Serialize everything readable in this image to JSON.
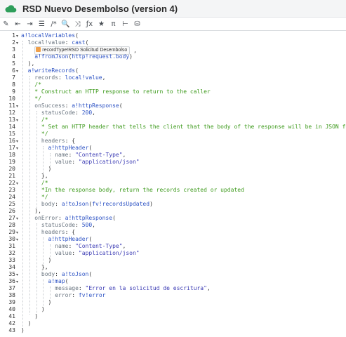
{
  "window": {
    "title": "RSD Nuevo Desembolso (version 4)"
  },
  "toolbar": {
    "icons": [
      "magic-wand-icon",
      "indent-left-icon",
      "indent-right-icon",
      "list-icon",
      "comment-icon",
      "search-icon",
      "shuffle-icon",
      "function-icon",
      "star-icon",
      "pi-icon",
      "expression-icon",
      "database-icon"
    ],
    "glyphs": [
      "✎",
      "⇤",
      "⇥",
      "☰",
      "/*",
      "🔍",
      "⤨",
      "ƒx",
      "★",
      "π",
      "⊢",
      "⛁"
    ]
  },
  "chip": {
    "label": "recordType!RSD Solicitud Desembolso"
  },
  "lines": [
    {
      "n": "1",
      "fold": true
    },
    {
      "n": "2",
      "fold": true
    },
    {
      "n": "3",
      "fold": false
    },
    {
      "n": "4",
      "fold": false
    },
    {
      "n": "5",
      "fold": false
    },
    {
      "n": "6",
      "fold": true
    },
    {
      "n": "7",
      "fold": false
    },
    {
      "n": "8",
      "fold": false
    },
    {
      "n": "9",
      "fold": false
    },
    {
      "n": "10",
      "fold": false
    },
    {
      "n": "11",
      "fold": true
    },
    {
      "n": "12",
      "fold": false
    },
    {
      "n": "13",
      "fold": true
    },
    {
      "n": "14",
      "fold": false
    },
    {
      "n": "15",
      "fold": false
    },
    {
      "n": "16",
      "fold": true
    },
    {
      "n": "17",
      "fold": true
    },
    {
      "n": "18",
      "fold": false
    },
    {
      "n": "19",
      "fold": false
    },
    {
      "n": "20",
      "fold": false
    },
    {
      "n": "21",
      "fold": false
    },
    {
      "n": "22",
      "fold": true
    },
    {
      "n": "23",
      "fold": false
    },
    {
      "n": "24",
      "fold": false
    },
    {
      "n": "25",
      "fold": false
    },
    {
      "n": "26",
      "fold": false
    },
    {
      "n": "27",
      "fold": true
    },
    {
      "n": "28",
      "fold": false
    },
    {
      "n": "29",
      "fold": true
    },
    {
      "n": "30",
      "fold": true
    },
    {
      "n": "31",
      "fold": false
    },
    {
      "n": "32",
      "fold": false
    },
    {
      "n": "33",
      "fold": false
    },
    {
      "n": "34",
      "fold": false
    },
    {
      "n": "35",
      "fold": true
    },
    {
      "n": "36",
      "fold": true
    },
    {
      "n": "37",
      "fold": false
    },
    {
      "n": "38",
      "fold": false
    },
    {
      "n": "39",
      "fold": false
    },
    {
      "n": "40",
      "fold": false
    },
    {
      "n": "41",
      "fold": false
    },
    {
      "n": "42",
      "fold": false
    },
    {
      "n": "43",
      "fold": false
    }
  ],
  "code": {
    "l1": [
      [
        "fn",
        "a!localVariables"
      ],
      [
        "pun",
        "("
      ]
    ],
    "l2": [
      [
        "key",
        "local!value"
      ],
      [
        "pun",
        ": "
      ],
      [
        "fn",
        "cast"
      ],
      [
        "pun",
        "("
      ]
    ],
    "l3": [
      [
        "pun",
        ","
      ]
    ],
    "l4": [
      [
        "fn",
        "a!fromJson"
      ],
      [
        "pun",
        "("
      ],
      [
        "fn",
        "http!request.body"
      ],
      [
        "pun",
        ")"
      ]
    ],
    "l5": [
      [
        "pun",
        "),"
      ]
    ],
    "l6": [
      [
        "fn",
        "a!writeRecords"
      ],
      [
        "pun",
        "("
      ]
    ],
    "l7": [
      [
        "key",
        "records"
      ],
      [
        "pun",
        ": "
      ],
      [
        "fn",
        "local!value"
      ],
      [
        "pun",
        ","
      ]
    ],
    "l8": [
      [
        "cm",
        "/*"
      ]
    ],
    "l9": [
      [
        "cm",
        "* Construct an HTTP response to return to the caller"
      ]
    ],
    "l10": [
      [
        "cm",
        "*/"
      ]
    ],
    "l11": [
      [
        "key",
        "onSuccess"
      ],
      [
        "pun",
        ": "
      ],
      [
        "fn",
        "a!httpResponse"
      ],
      [
        "pun",
        "("
      ]
    ],
    "l12": [
      [
        "key",
        "statusCode"
      ],
      [
        "pun",
        ": "
      ],
      [
        "num",
        "200"
      ],
      [
        "pun",
        ","
      ]
    ],
    "l13": [
      [
        "cm",
        "/*"
      ]
    ],
    "l14": [
      [
        "cm",
        "* Set an HTTP header that tells the client that the body of the response will be in JSON format"
      ]
    ],
    "l15": [
      [
        "cm",
        "*/"
      ]
    ],
    "l16": [
      [
        "key",
        "headers"
      ],
      [
        "pun",
        ": {"
      ]
    ],
    "l17": [
      [
        "fn",
        "a!httpHeader"
      ],
      [
        "pun",
        "("
      ]
    ],
    "l18": [
      [
        "key",
        "name"
      ],
      [
        "pun",
        ": "
      ],
      [
        "str",
        "\"Content-Type\""
      ],
      [
        "pun",
        ","
      ]
    ],
    "l19": [
      [
        "key",
        "value"
      ],
      [
        "pun",
        ": "
      ],
      [
        "str",
        "\"application/json\""
      ]
    ],
    "l20": [
      [
        "pun",
        ")"
      ]
    ],
    "l21": [
      [
        "pun",
        "},"
      ]
    ],
    "l22": [
      [
        "cm",
        "/*"
      ]
    ],
    "l23": [
      [
        "cm",
        "*In the response body, return the records created or updated"
      ]
    ],
    "l24": [
      [
        "cm",
        "*/"
      ]
    ],
    "l25": [
      [
        "key",
        "body"
      ],
      [
        "pun",
        ": "
      ],
      [
        "fn",
        "a!toJson"
      ],
      [
        "pun",
        "("
      ],
      [
        "fn",
        "fv!recordsUpdated"
      ],
      [
        "pun",
        ")"
      ]
    ],
    "l26": [
      [
        "pun",
        "),"
      ]
    ],
    "l27": [
      [
        "key",
        "onError"
      ],
      [
        "pun",
        ": "
      ],
      [
        "fn",
        "a!httpResponse"
      ],
      [
        "pun",
        "("
      ]
    ],
    "l28": [
      [
        "key",
        "statusCode"
      ],
      [
        "pun",
        ": "
      ],
      [
        "num",
        "500"
      ],
      [
        "pun",
        ","
      ]
    ],
    "l29": [
      [
        "key",
        "headers"
      ],
      [
        "pun",
        ": {"
      ]
    ],
    "l30": [
      [
        "fn",
        "a!httpHeader"
      ],
      [
        "pun",
        "("
      ]
    ],
    "l31": [
      [
        "key",
        "name"
      ],
      [
        "pun",
        ": "
      ],
      [
        "str",
        "\"Content-Type\""
      ],
      [
        "pun",
        ","
      ]
    ],
    "l32": [
      [
        "key",
        "value"
      ],
      [
        "pun",
        ": "
      ],
      [
        "str",
        "\"application/json\""
      ]
    ],
    "l33": [
      [
        "pun",
        ")"
      ]
    ],
    "l34": [
      [
        "pun",
        "},"
      ]
    ],
    "l35": [
      [
        "key",
        "body"
      ],
      [
        "pun",
        ": "
      ],
      [
        "fn",
        "a!toJson"
      ],
      [
        "pun",
        "("
      ]
    ],
    "l36": [
      [
        "fn",
        "a!map"
      ],
      [
        "pun",
        "("
      ]
    ],
    "l37": [
      [
        "key",
        "message"
      ],
      [
        "pun",
        ": "
      ],
      [
        "str",
        "\"Error en la solicitud de escritura\""
      ],
      [
        "pun",
        ","
      ]
    ],
    "l38": [
      [
        "key",
        "error"
      ],
      [
        "pun",
        ": "
      ],
      [
        "fn",
        "fv!error"
      ]
    ],
    "l39": [
      [
        "pun",
        ")"
      ]
    ],
    "l40": [
      [
        "pun",
        ")"
      ]
    ],
    "l41": [
      [
        "pun",
        ")"
      ]
    ],
    "l42": [
      [
        "pun",
        ")"
      ]
    ],
    "l43": [
      [
        "pun",
        ")"
      ]
    ]
  },
  "colors": {
    "function": "#2c52c4",
    "comment": "#3d9a1c",
    "string": "#3b3bb4",
    "key": "#6a7580"
  }
}
